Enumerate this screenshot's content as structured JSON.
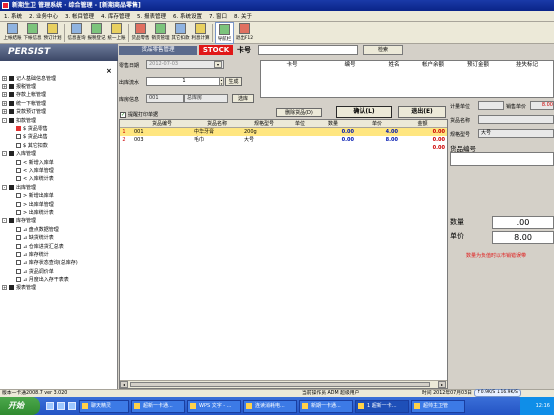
{
  "window": {
    "title": "新期生卫 管理系统 · 综合管理 - [新期商品零售]"
  },
  "menu": [
    "1. 系统",
    "2. 业务中心",
    "3. 帐目管理",
    "4. 库存管理",
    "5. 报表管理",
    "6. 系统设置",
    "7. 窗口",
    "8. 关于"
  ],
  "toolbar": [
    {
      "label": "上帐结账",
      "icon": "ledger-icon",
      "c": ""
    },
    {
      "label": "下帐信息",
      "icon": "download-icon",
      "c": "g"
    },
    {
      "label": "预订计划",
      "icon": "plan-icon",
      "c": "y"
    },
    {
      "label": "信息查询",
      "icon": "info-icon",
      "c": ""
    },
    {
      "label": "报税登记",
      "icon": "tax-icon",
      "c": "g"
    },
    {
      "label": "统一上账",
      "icon": "upload-icon",
      "c": "y"
    },
    {
      "label": "货品零售",
      "icon": "retail-icon",
      "c": "r"
    },
    {
      "label": "销货管理",
      "icon": "sales-icon",
      "c": "g"
    },
    {
      "label": "其它扣款",
      "icon": "deduct-icon",
      "c": ""
    },
    {
      "label": "利息计算",
      "icon": "interest-icon",
      "c": "y"
    },
    {
      "label": "导航栏",
      "icon": "nav-icon",
      "c": "g",
      "active": true
    },
    {
      "label": "退出F12",
      "icon": "exit-icon",
      "c": "r"
    }
  ],
  "left": {
    "title": "PERSIST",
    "close": "×",
    "tree": [
      {
        "t": "expander",
        "label": "记人基础信息管理",
        "lvl": 0,
        "exp": "+"
      },
      {
        "t": "node",
        "label": "报税管理",
        "lvl": 0,
        "exp": "+"
      },
      {
        "t": "node",
        "label": "存款上帐管理",
        "lvl": 0,
        "exp": "+"
      },
      {
        "t": "node",
        "label": "统一下帐管理",
        "lvl": 0,
        "exp": "+"
      },
      {
        "t": "node",
        "label": "贷款预订管理",
        "lvl": 0,
        "exp": "+"
      },
      {
        "t": "node",
        "label": "扣款管理",
        "lvl": 0,
        "exp": "-"
      },
      {
        "t": "leaf",
        "label": "$ 货品零售",
        "lvl": 1,
        "sel": true
      },
      {
        "t": "leaf",
        "label": "$ 货品出售",
        "lvl": 1
      },
      {
        "t": "leaf",
        "label": "$ 其它扣款",
        "lvl": 1
      },
      {
        "t": "node",
        "label": "入库管理",
        "lvl": 0,
        "exp": "-"
      },
      {
        "t": "leaf",
        "label": "<  新增入库单",
        "lvl": 1
      },
      {
        "t": "leaf",
        "label": "<  入库单管理",
        "lvl": 1
      },
      {
        "t": "leaf",
        "label": "<  入库统计表",
        "lvl": 1
      },
      {
        "t": "node",
        "label": "出库管理",
        "lvl": 0,
        "exp": "-"
      },
      {
        "t": "leaf",
        "label": ">  新增出库单",
        "lvl": 1
      },
      {
        "t": "leaf",
        "label": ">  出库单管理",
        "lvl": 1
      },
      {
        "t": "leaf",
        "label": ">  出库统计表",
        "lvl": 1
      },
      {
        "t": "node",
        "label": "库存管理",
        "lvl": 0,
        "exp": "-"
      },
      {
        "t": "leaf",
        "label": "⊿  盘点数据管理",
        "lvl": 1
      },
      {
        "t": "leaf",
        "label": "⊿  缺货统计表",
        "lvl": 1
      },
      {
        "t": "leaf",
        "label": "⊿  仓库进货汇总表",
        "lvl": 1
      },
      {
        "t": "leaf",
        "label": "⊿  库存统计",
        "lvl": 1
      },
      {
        "t": "leaf",
        "label": "⊿  库存状态查询(总库存)",
        "lvl": 1
      },
      {
        "t": "leaf",
        "label": "⊿  货品调价单",
        "lvl": 1
      },
      {
        "t": "leaf",
        "label": "⊿  月度出入存干表表",
        "lvl": 1
      },
      {
        "t": "node",
        "label": "报表管理",
        "lvl": 0,
        "exp": "+"
      }
    ]
  },
  "form": {
    "header_label": "货品零售管理",
    "stock_badge": "STOCK",
    "card_label": "卡号",
    "search_btn": "检索",
    "date_label": "零售日期",
    "date_value": "2012-07-03",
    "serial_label": "出库流水",
    "serial_value": "1",
    "generate_btn": "生成",
    "warehouse_label": "库房信息",
    "warehouse_code": "001",
    "warehouse_name": "总库房",
    "choose_btn": "选库",
    "print_check": "提醒打印单据",
    "delete_btn": "删除货品(D)",
    "confirm_btn": "确认(L)",
    "exit_btn": "退出(E)"
  },
  "member_table": {
    "headers": [
      "卡号",
      "编号",
      "姓名",
      "帐户余额",
      "预订金额",
      "挂失标记"
    ]
  },
  "grid": {
    "headers": [
      "",
      "货品编号",
      "货品名称",
      "规格型号",
      "单位",
      "数量",
      "单价",
      "金额"
    ],
    "rows": [
      {
        "no": "1",
        "code": "001",
        "name": "中华牙膏",
        "spec": "200g",
        "unit": "",
        "qty": "0.00",
        "price": "4.00",
        "amount": "0.00"
      },
      {
        "no": "2",
        "code": "003",
        "name": "毛巾",
        "spec": "大号",
        "unit": "",
        "qty": "0.00",
        "price": "8.00",
        "amount": "0.00"
      }
    ],
    "total": "0.00"
  },
  "side": {
    "unit_label": "计量单位",
    "saleprice_label": "销售单价",
    "saleprice_value": "8.00",
    "goodsname_label": "货品名称",
    "spec_label": "规格型号",
    "spec_value": "大号",
    "goods_code_label": "货品编号",
    "qty_label": "数量",
    "qty_value": ".00",
    "price_label": "单价",
    "price_value": "8.00",
    "warn": "数量为负值时以市销错误带"
  },
  "status": {
    "version": "版本一卡通2008.7 ver 3.020",
    "operator": "当前操作员 ADM 超级用户",
    "time": "时间 2012年07月03日"
  },
  "speed": {
    "up": "0.9K/S",
    "down": "16.9K/S"
  },
  "taskbar": {
    "start": "开始",
    "tasks": [
      "聊天精灵",
      "超新一卡通...",
      "WPS 文字 - ...",
      "连读消耗电...",
      "新期一卡通...",
      "1 超新一卡...",
      "超帅主卫管"
    ],
    "clock": "12:16"
  }
}
